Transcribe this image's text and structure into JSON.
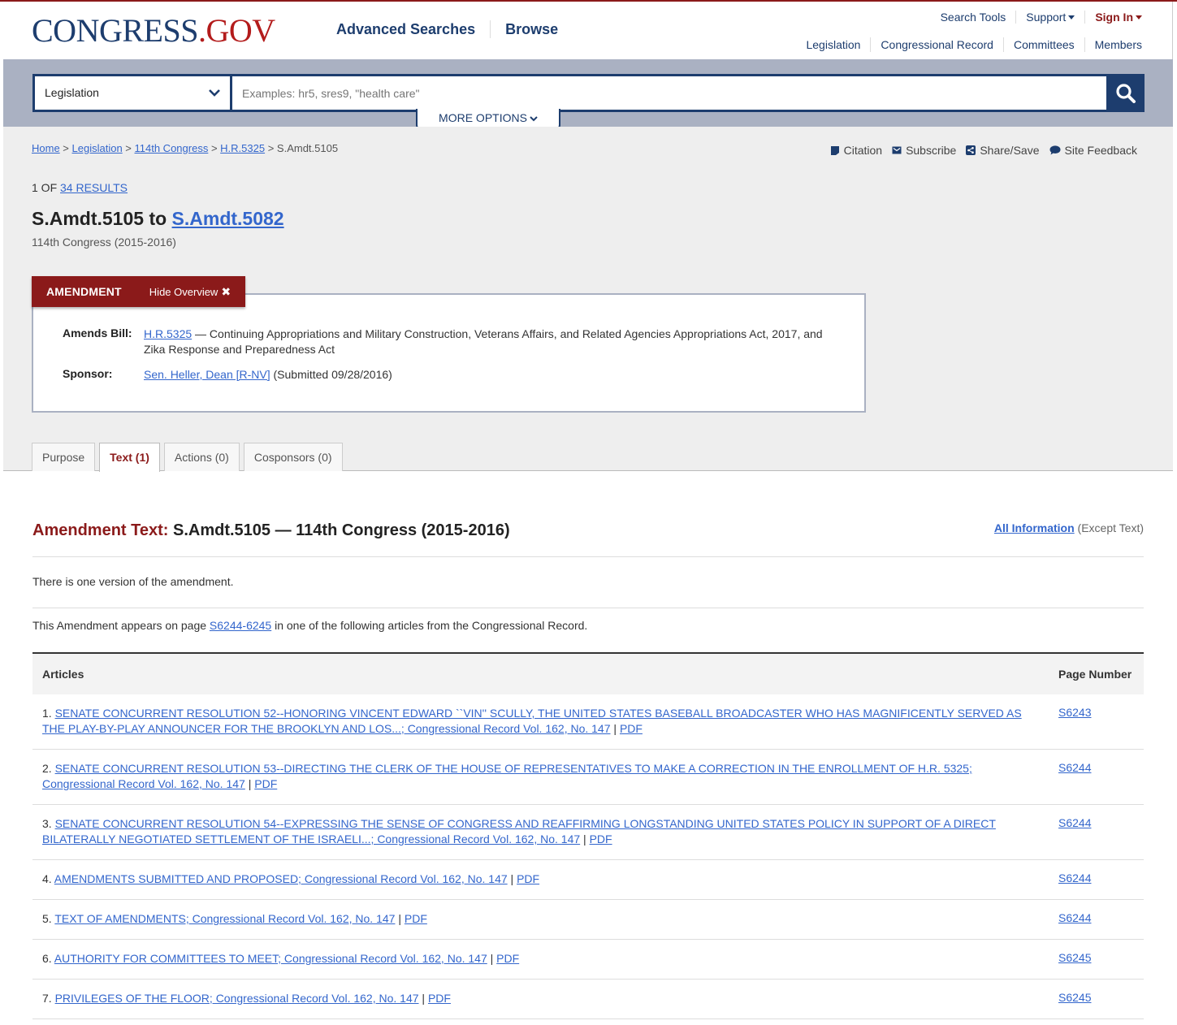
{
  "header": {
    "logo_part1": "CONGRESS",
    "logo_dot": ".",
    "logo_part2": "GOV",
    "nav": [
      "Advanced Searches",
      "Browse"
    ],
    "util": {
      "search_tools": "Search Tools",
      "support": "Support",
      "sign_in": "Sign In"
    },
    "secondary": [
      "Legislation",
      "Congressional Record",
      "Committees",
      "Members"
    ]
  },
  "search": {
    "collection": "Legislation",
    "placeholder": "Examples: hr5, sres9, \"health care\"",
    "more_options": "MORE OPTIONS"
  },
  "breadcrumb": {
    "home": "Home",
    "legislation": "Legislation",
    "congress": "114th Congress",
    "bill": "H.R.5325",
    "current": "S.Amdt.5105"
  },
  "tools": [
    "Citation",
    "Subscribe",
    "Share/Save",
    "Site Feedback"
  ],
  "results": {
    "prefix": "1 OF",
    "link": "34 RESULTS"
  },
  "title": {
    "main": "S.Amdt.5105 to",
    "link": "S.Amdt.5082"
  },
  "subtitle": "114th Congress (2015-2016)",
  "overview": {
    "tab_label": "AMENDMENT",
    "hide_label": "Hide Overview",
    "amends_label": "Amends Bill:",
    "amends_link": "H.R.5325",
    "amends_text": " — Continuing Appropriations and Military Construction, Veterans Affairs, and Related Agencies Appropriations Act, 2017, and Zika Response and Preparedness Act",
    "sponsor_label": "Sponsor:",
    "sponsor_link": "Sen. Heller, Dean [R-NV]",
    "sponsor_text": " (Submitted 09/28/2016)"
  },
  "tabs": [
    "Purpose",
    "Text (1)",
    "Actions (0)",
    "Cosponsors (0)"
  ],
  "content": {
    "heading_lead": "Amendment Text:",
    "heading_rest": " S.Amdt.5105 — 114th Congress (2015-2016)",
    "all_info_link": "All Information",
    "all_info_suffix": " (Except Text)",
    "versions_text": "There is one version of the amendment.",
    "appears_prefix": "This Amendment appears on page ",
    "appears_link": "S6244-6245",
    "appears_suffix": " in one of the following articles from the Congressional Record."
  },
  "table": {
    "headers": [
      "Articles",
      "Page Number"
    ],
    "rows": [
      {
        "num": "1. ",
        "title": "SENATE CONCURRENT RESOLUTION 52--HONORING VINCENT EDWARD ``VIN'' SCULLY, THE UNITED STATES BASEBALL BROADCASTER WHO HAS MAGNIFICENTLY SERVED AS THE PLAY-BY-PLAY ANNOUNCER FOR THE BROOKLYN AND LOS...; Congressional Record Vol. 162, No. 147",
        "pdf": "PDF",
        "page": "S6243"
      },
      {
        "num": "2. ",
        "title": "SENATE CONCURRENT RESOLUTION 53--DIRECTING THE CLERK OF THE HOUSE OF REPRESENTATIVES TO MAKE A CORRECTION IN THE ENROLLMENT OF H.R. 5325; Congressional Record Vol. 162, No. 147",
        "pdf": "PDF",
        "page": "S6244"
      },
      {
        "num": "3. ",
        "title": "SENATE CONCURRENT RESOLUTION 54--EXPRESSING THE SENSE OF CONGRESS AND REAFFIRMING LONGSTANDING UNITED STATES POLICY IN SUPPORT OF A DIRECT BILATERALLY NEGOTIATED SETTLEMENT OF THE ISRAELI...; Congressional Record Vol. 162, No. 147",
        "pdf": "PDF",
        "page": "S6244"
      },
      {
        "num": "4. ",
        "title": "AMENDMENTS SUBMITTED AND PROPOSED; Congressional Record Vol. 162, No. 147",
        "pdf": "PDF",
        "page": "S6244"
      },
      {
        "num": "5. ",
        "title": "TEXT OF AMENDMENTS; Congressional Record Vol. 162, No. 147",
        "pdf": "PDF",
        "page": "S6244"
      },
      {
        "num": "6. ",
        "title": "AUTHORITY FOR COMMITTEES TO MEET; Congressional Record Vol. 162, No. 147",
        "pdf": "PDF",
        "page": "S6245"
      },
      {
        "num": "7. ",
        "title": "PRIVILEGES OF THE FLOOR; Congressional Record Vol. 162, No. 147",
        "pdf": "PDF",
        "page": "S6245"
      }
    ]
  },
  "colors": {
    "navy": "#1d3d6e",
    "red": "#b31b1b",
    "maroon": "#8b1a1a",
    "link": "#3366cc",
    "band": "#aab1c2"
  }
}
